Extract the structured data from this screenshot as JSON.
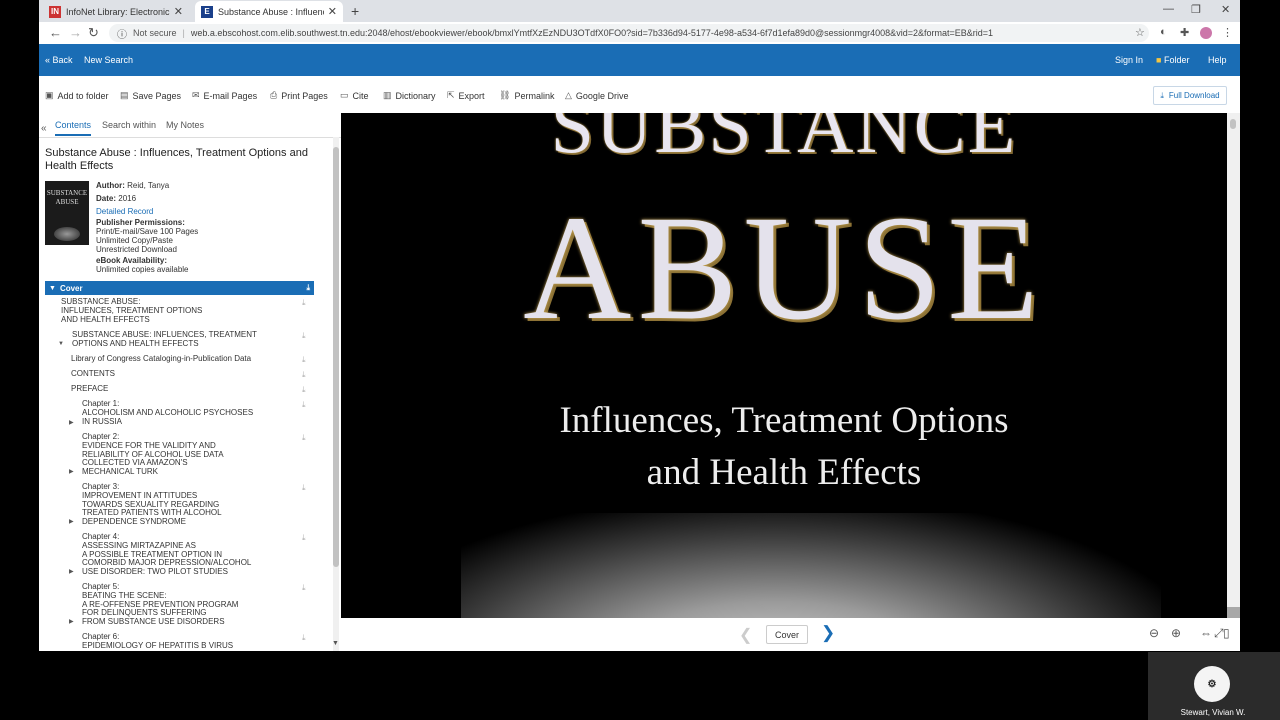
{
  "browser": {
    "tabs": [
      {
        "title": "InfoNet Library: Electronic Databa",
        "icon": "infonet-favicon"
      },
      {
        "title": "Substance Abuse : Influences, Tre",
        "icon": "ebsco-favicon"
      }
    ],
    "new_tab": "+",
    "not_secure": "Not secure",
    "url": "web.a.ebscohost.com.elib.southwest.tn.edu:2048/ehost/ebookviewer/ebook/bmxlYmtfXzEzNDU3OTdfX0FO0?sid=7b336d94-5177-4e98-a534-6f7d1efa89d0@sessionmgr4008&vid=2&format=EB&rid=1"
  },
  "bluebar": {
    "back": "« Back",
    "new_search": "New Search",
    "sign_in": "Sign In",
    "folder": "Folder",
    "help": "Help"
  },
  "toolbar": {
    "add_to_folder": "Add to folder",
    "save_pages": "Save Pages",
    "email_pages": "E-mail Pages",
    "print_pages": "Print Pages",
    "cite": "Cite",
    "dictionary": "Dictionary",
    "export": "Export",
    "permalink": "Permalink",
    "google_drive": "Google Drive",
    "full_download": "Full Download"
  },
  "sidebar": {
    "tabs": [
      "Contents",
      "Search within",
      "My Notes"
    ],
    "title": "Substance Abuse : Influences, Treatment Options and Health Effects",
    "cover_thumb": {
      "line1": "SUBSTANCE",
      "line2": "ABUSE"
    },
    "author_label": "Author:",
    "author": "Reid, Tanya",
    "date_label": "Date:",
    "date": "2016",
    "detailed_record": "Detailed Record",
    "permissions_label": "Publisher Permissions:",
    "permissions": [
      "Print/E-mail/Save 100 Pages",
      "Unlimited Copy/Paste",
      "Unrestricted Download"
    ],
    "availability_label": "eBook Availability:",
    "availability": "Unlimited copies available",
    "toc_header": "Cover",
    "toc": [
      {
        "lines": [
          "SUBSTANCE ABUSE:",
          "INFLUENCES, TREATMENT OPTIONS",
          "AND HEALTH EFFECTS"
        ]
      },
      {
        "lines": [
          "SUBSTANCE ABUSE: INFLUENCES, TREATMENT",
          "OPTIONS AND HEALTH EFFECTS"
        ]
      },
      {
        "lines": [
          "Library of Congress Cataloging-in-Publication Data"
        ]
      },
      {
        "lines": [
          "CONTENTS"
        ]
      },
      {
        "lines": [
          "PREFACE"
        ]
      },
      {
        "lines": [
          "Chapter 1:",
          "ALCOHOLISM AND ALCOHOLIC PSYCHOSES",
          "IN RUSSIA"
        ]
      },
      {
        "lines": [
          "Chapter 2:",
          "EVIDENCE FOR THE VALIDITY AND",
          "RELIABILITY OF ALCOHOL USE DATA",
          "COLLECTED VIA AMAZON'S",
          "MECHANICAL TURK"
        ]
      },
      {
        "lines": [
          "Chapter 3:",
          "IMPROVEMENT IN ATTITUDES",
          "TOWARDS SEXUALITY REGARDING",
          "TREATED PATIENTS WITH ALCOHOL",
          "DEPENDENCE SYNDROME"
        ]
      },
      {
        "lines": [
          "Chapter 4:",
          "ASSESSING MIRTAZAPINE AS",
          "A POSSIBLE TREATMENT OPTION IN",
          "COMORBID MAJOR DEPRESSION/ALCOHOL",
          "USE DISORDER: TWO PILOT STUDIES"
        ]
      },
      {
        "lines": [
          "Chapter 5:",
          "BEATING THE SCENE:",
          "A RE-OFFENSE PREVENTION PROGRAM",
          "FOR DELINQUENTS SUFFERING",
          "FROM SUBSTANCE USE DISORDERS"
        ]
      },
      {
        "lines": [
          "Chapter 6:",
          "EPIDEMIOLOGY OF HEPATITIS B VIRUS"
        ]
      }
    ]
  },
  "viewer": {
    "cover_top": "SUBSTANCE",
    "cover_main": "ABUSE",
    "cover_sub1": "Influences, Treatment Options",
    "cover_sub2": "and Health Effects",
    "page_label": "Cover"
  },
  "webcam": {
    "name": "Stewart, Vivian W."
  },
  "colors": {
    "accent": "#1a6db5",
    "tabstrip": "#dee1e6"
  }
}
